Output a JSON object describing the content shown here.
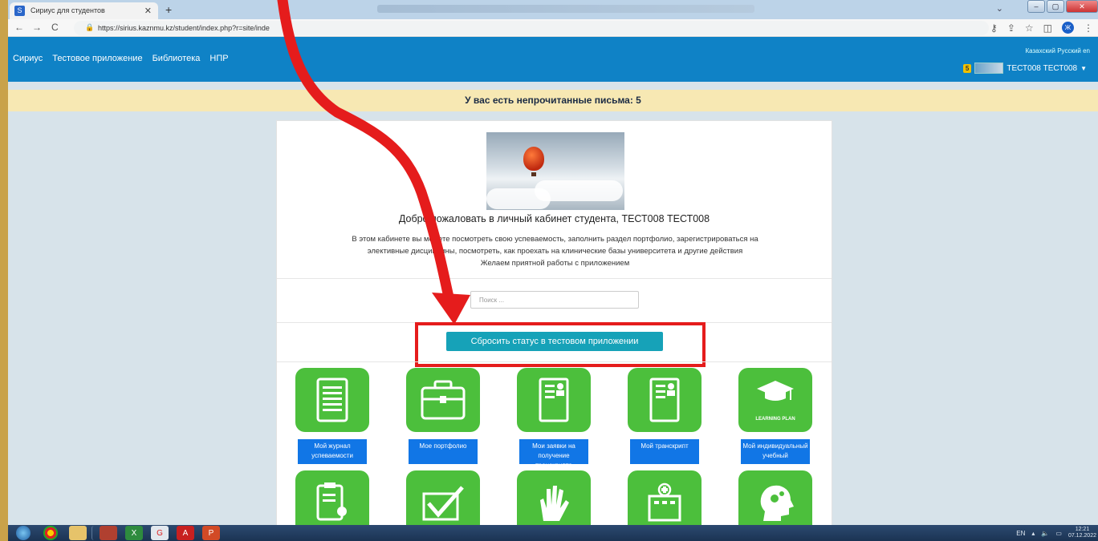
{
  "browser": {
    "tab_title": "Сириус для студентов",
    "tab_favicon": "S",
    "url": "https://sirius.kaznmu.kz/student/index.php?r=site/inde"
  },
  "app": {
    "languages": "Казахский Русский en",
    "menu": [
      "Сириус",
      "Тестовое приложение",
      "Библиотека",
      "НПР"
    ],
    "user_badge": "5",
    "user_name": "ТЕСТ008 ТЕСТ008"
  },
  "notice": "У вас есть непрочитанные письма: 5",
  "welcome": {
    "title": "Добро пожаловать в личный кабинет студента, ТЕСТ008 ТЕСТ008",
    "line1": "В этом кабинете вы можете посмотреть свою успеваемость, заполнить раздел портфолио, зарегистрироваться на",
    "line2": "элективные дисциплины, посмотреть, как проехать на клинические базы университета и другие действия",
    "line3": "Желаем приятной работы с приложением"
  },
  "search": {
    "placeholder": "Поиск ..."
  },
  "reset_button": "Сбросить статус в тестовом приложении",
  "tiles": [
    {
      "label": "Мой журнал успеваемости",
      "icon": "gradebook-icon"
    },
    {
      "label": "Мое портфолио",
      "icon": "briefcase-icon"
    },
    {
      "label": "Мои заявки на получение транскрипта",
      "icon": "document-id-icon"
    },
    {
      "label": "Мой транскрипт",
      "icon": "transcript-icon"
    },
    {
      "label": "Мой индивидуальный учебный",
      "icon": "learning-plan-icon",
      "icon_text": "LEARNING PLAN"
    }
  ],
  "tiles_row2": [
    {
      "icon": "clipboard-graduate-icon"
    },
    {
      "icon": "checkmark-icon"
    },
    {
      "icon": "hands-icon"
    },
    {
      "icon": "hospital-icon"
    },
    {
      "icon": "head-gears-icon"
    }
  ],
  "taskbar": {
    "lang": "EN",
    "time": "12:21",
    "date": "07.12.2022"
  },
  "colors": {
    "navbar": "#0f82c6",
    "notice_bg": "#f7e8b3",
    "tile_green": "#4cbf3c",
    "tile_label_blue": "#1176e6",
    "reset_button": "#16a2b8",
    "annotation_red": "#e51c1c"
  }
}
